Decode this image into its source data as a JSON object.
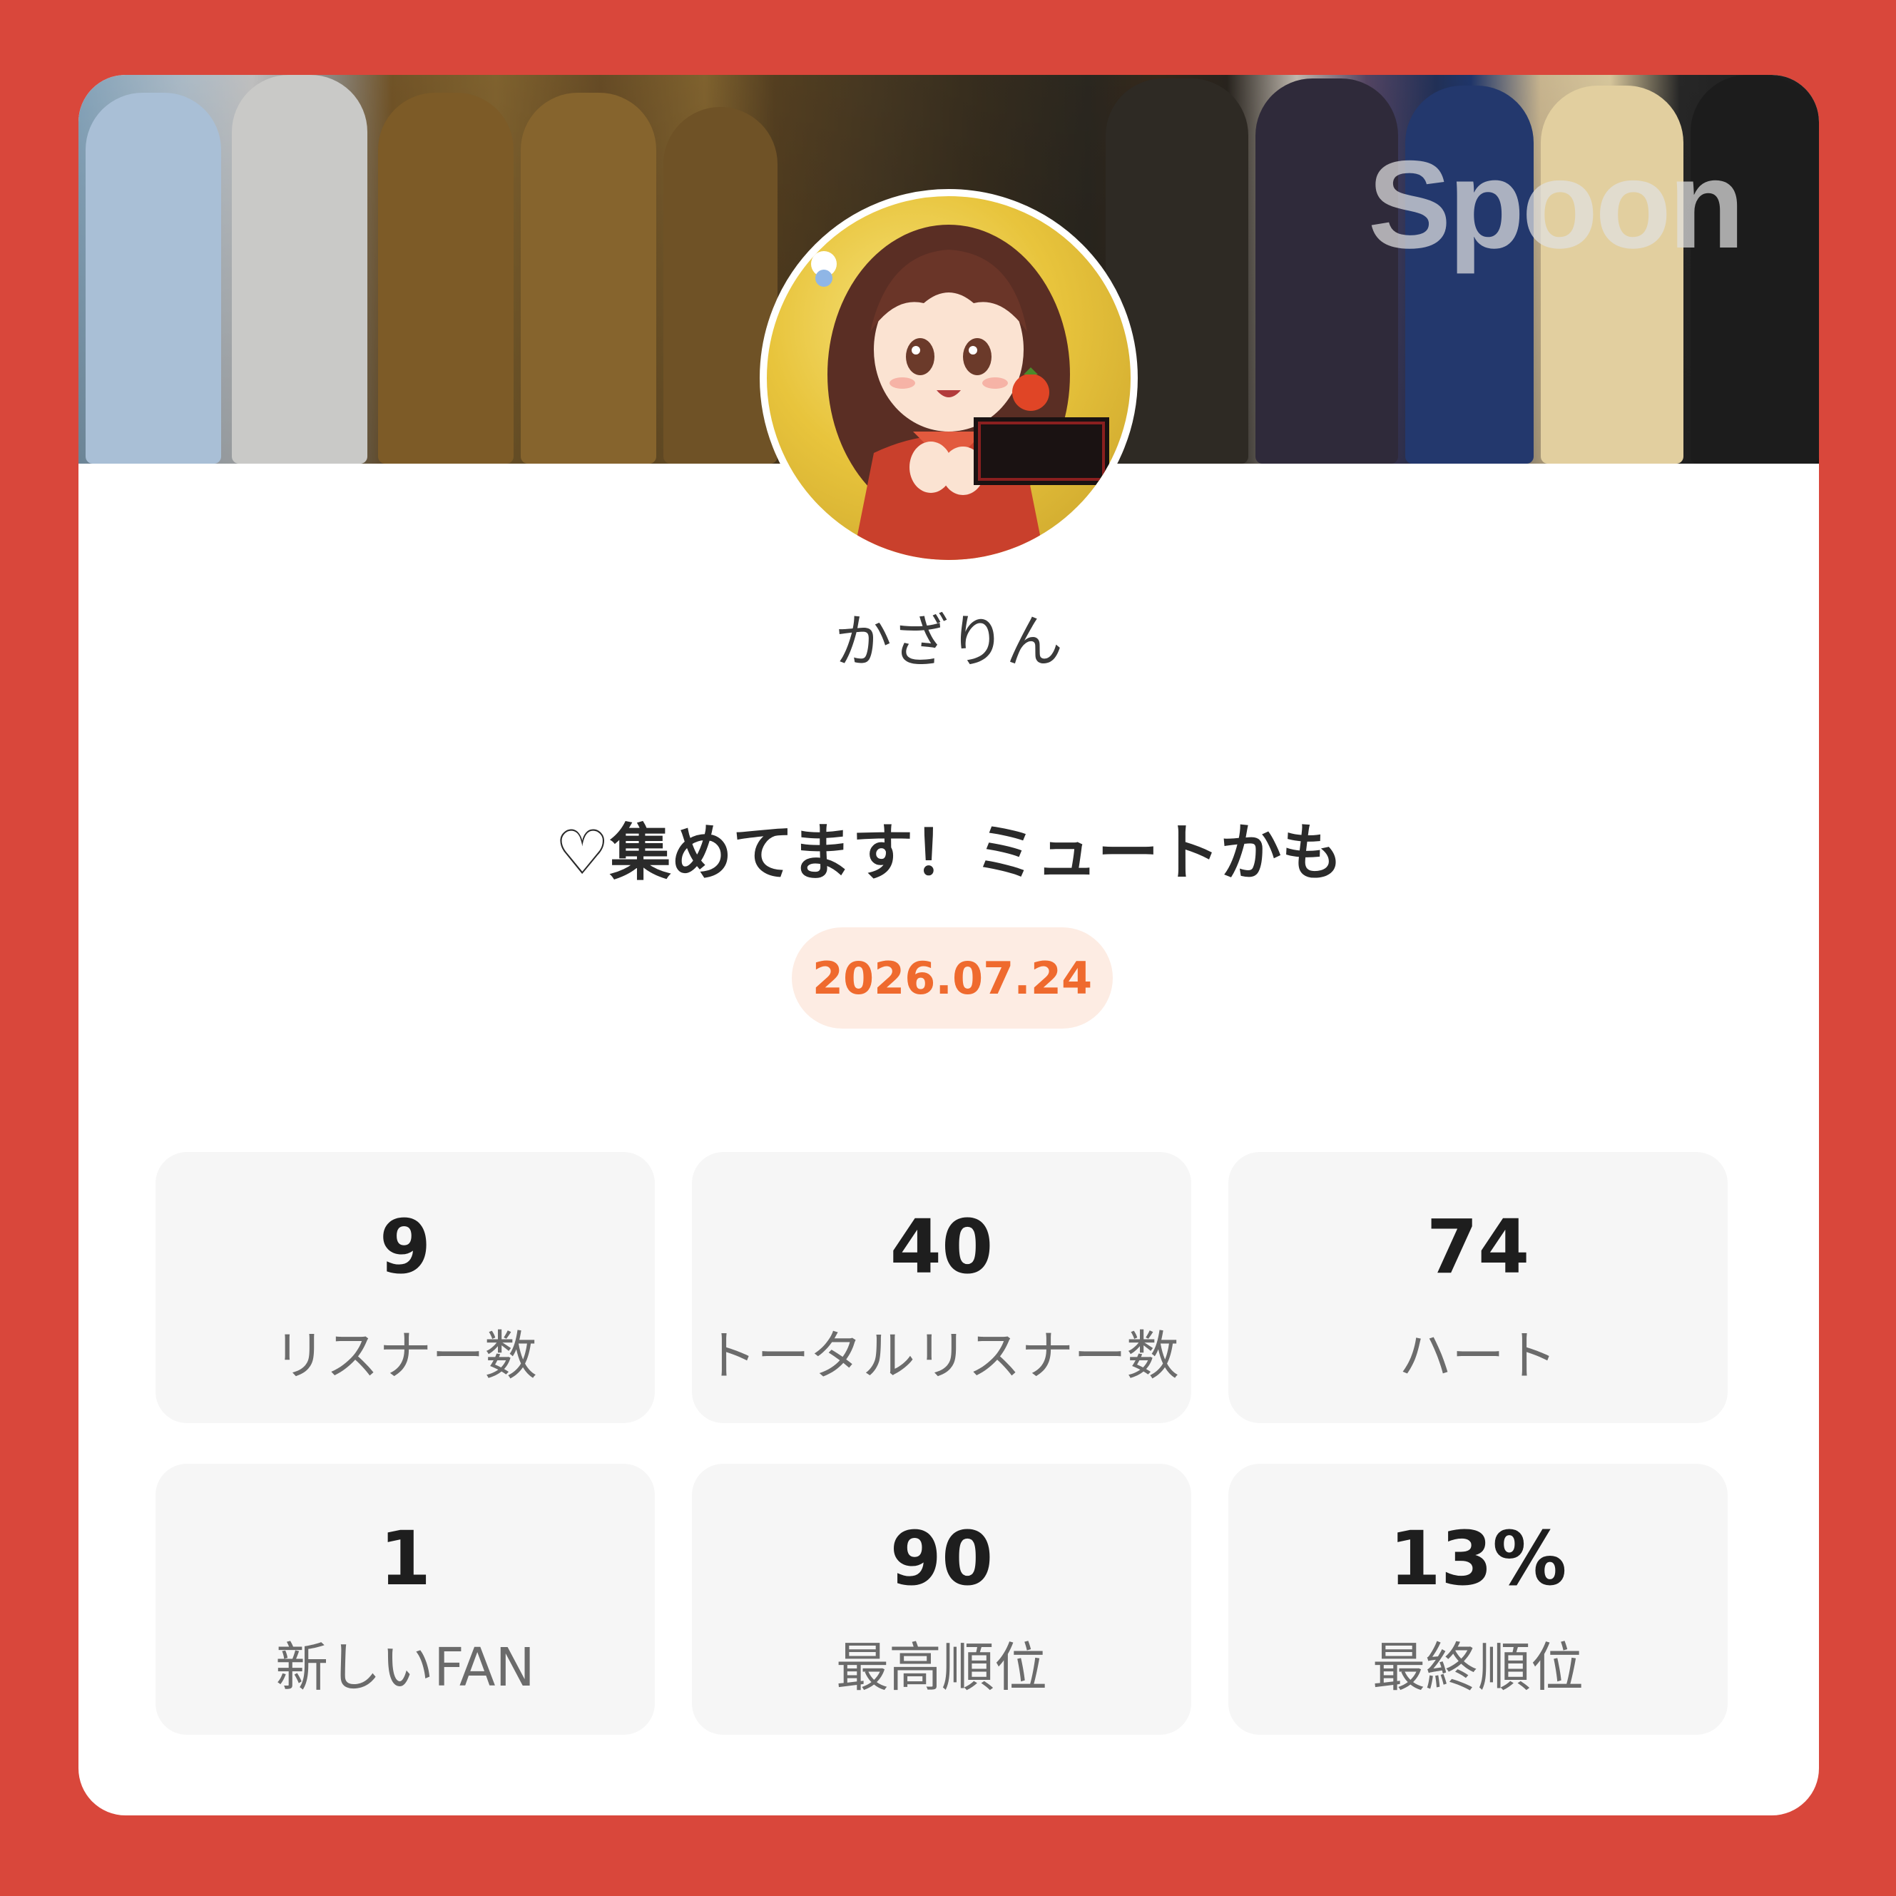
{
  "brand": {
    "logo_text": "Spoon"
  },
  "profile": {
    "username": "かざりん",
    "title": "♡集めてます！ミュートかも",
    "date": "2026.07.24"
  },
  "stats": [
    {
      "value": "9",
      "label": "リスナー数"
    },
    {
      "value": "40",
      "label": "トータルリスナー数"
    },
    {
      "value": "74",
      "label": "ハート"
    },
    {
      "value": "1",
      "label": "新しいFAN"
    },
    {
      "value": "90",
      "label": "最高順位"
    },
    {
      "value": "13%",
      "label": "最終順位"
    }
  ],
  "colors": {
    "background": "#d9473b",
    "accent": "#ef6a2e",
    "date_pill_bg": "#fdece3",
    "stat_card_bg": "#f6f6f6"
  }
}
